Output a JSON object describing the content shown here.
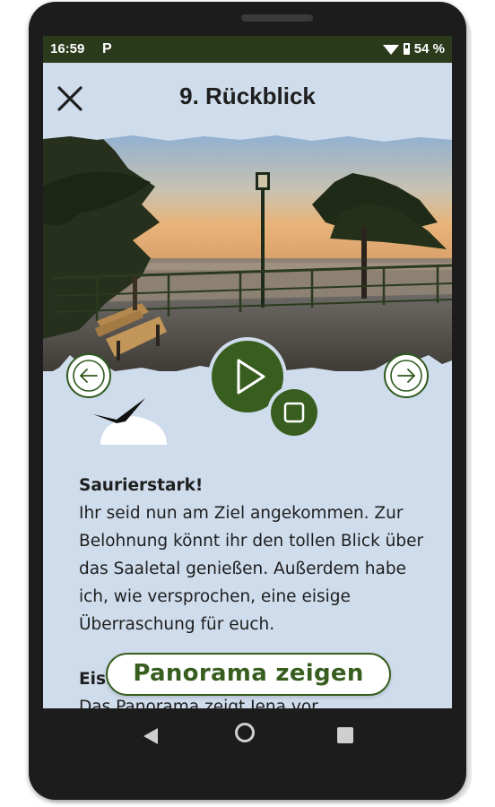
{
  "status_bar": {
    "time": "16:59",
    "notification_icon": "P",
    "battery_percent": "54 %",
    "icons": [
      "wifi-icon",
      "battery-icon"
    ]
  },
  "header": {
    "title": "9. Rückblick",
    "close_icon": "close-icon"
  },
  "media": {
    "prev_icon": "arrow-left-icon",
    "next_icon": "arrow-right-icon",
    "play_icon": "play-icon",
    "stop_icon": "stop-icon"
  },
  "content": {
    "paragraphs": [
      {
        "heading": "Saurierstark!",
        "text": "Ihr seid nun am Ziel angekommen. Zur Belohnung könnt ihr den tollen Blick über das Saaletal genießen. Außerdem habe ich, wie versprochen, eine eisige Überraschung für euch."
      },
      {
        "heading": "Eis.",
        "text": "Das Panorama zeigt Jena vor"
      }
    ]
  },
  "panorama_button": {
    "label": "Panorama zeigen"
  },
  "colors": {
    "accent": "#385e1f",
    "background": "#cfdcec",
    "status_bar": "#2c3a1c"
  },
  "system_nav": {
    "icons": [
      "back-icon",
      "home-icon",
      "recents-icon"
    ]
  }
}
